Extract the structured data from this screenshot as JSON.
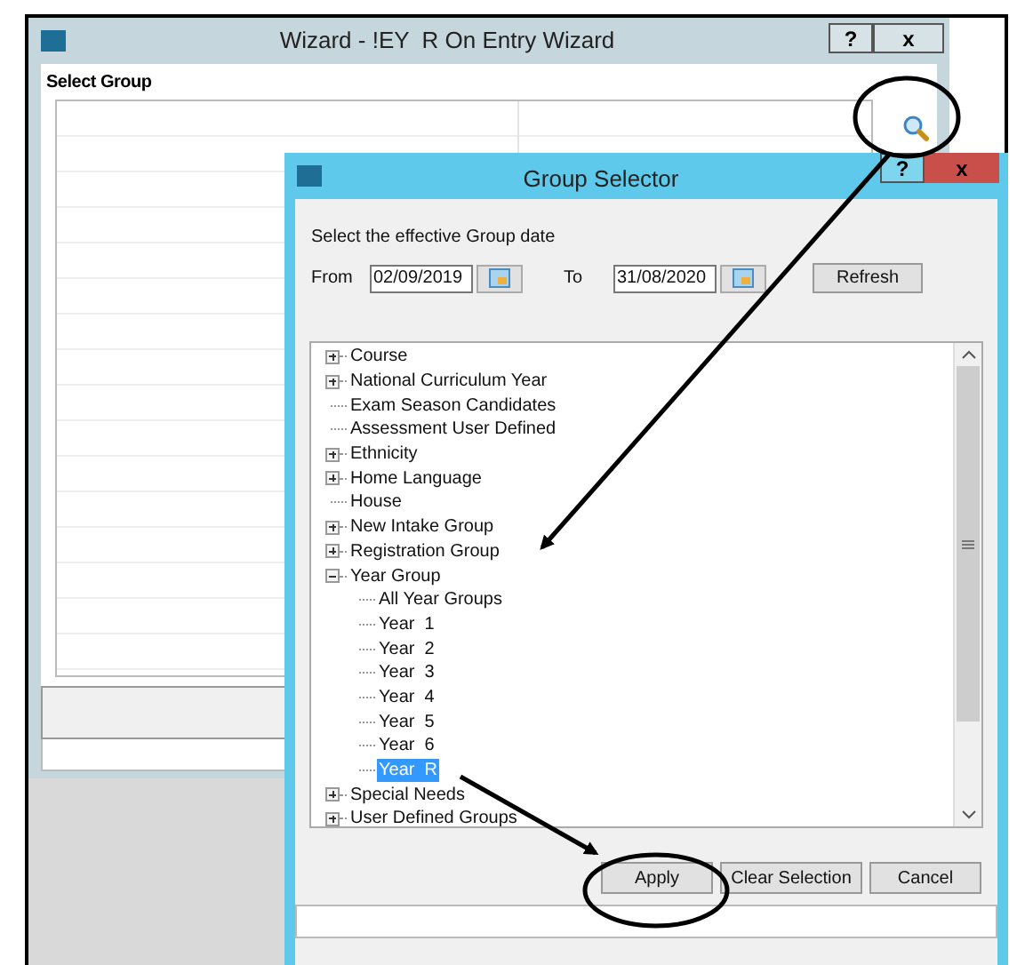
{
  "wizard": {
    "title": "Wizard - !EY  R On Entry Wizard",
    "help_button": "?",
    "close_button": "x",
    "section_label": "Select Group"
  },
  "dialog": {
    "title": "Group Selector",
    "help_button": "?",
    "close_button": "x",
    "prompt": "Select the effective Group date",
    "from_label": "From",
    "from_value": "02/09/2019",
    "to_label": "To",
    "to_value": "31/08/2020",
    "refresh_button": "Refresh",
    "tree": [
      {
        "label": "Course",
        "expanded": false,
        "selected": false
      },
      {
        "label": "National Curriculum Year",
        "expanded": false,
        "selected": false
      },
      {
        "label": "Exam Season Candidates",
        "selected": false
      },
      {
        "label": "Assessment User Defined",
        "selected": false
      },
      {
        "label": "Ethnicity",
        "expanded": false,
        "selected": false
      },
      {
        "label": "Home Language",
        "expanded": false,
        "selected": false
      },
      {
        "label": "House",
        "selected": false
      },
      {
        "label": "New Intake Group",
        "expanded": false,
        "selected": false
      },
      {
        "label": "Registration Group",
        "expanded": false,
        "selected": false
      },
      {
        "label": "Year Group",
        "expanded": true,
        "selected": false,
        "children": [
          {
            "label": "All Year Groups",
            "selected": false
          },
          {
            "label": "Year  1",
            "selected": false
          },
          {
            "label": "Year  2",
            "selected": false
          },
          {
            "label": "Year  3",
            "selected": false
          },
          {
            "label": "Year  4",
            "selected": false
          },
          {
            "label": "Year  5",
            "selected": false
          },
          {
            "label": "Year  6",
            "selected": false
          },
          {
            "label": "Year  R",
            "selected": true
          }
        ]
      },
      {
        "label": "Special Needs",
        "expanded": false,
        "selected": false
      },
      {
        "label": "User Defined Groups",
        "expanded": false,
        "selected": false
      }
    ],
    "buttons": [
      "Apply",
      "Clear Selection",
      "Cancel"
    ]
  }
}
